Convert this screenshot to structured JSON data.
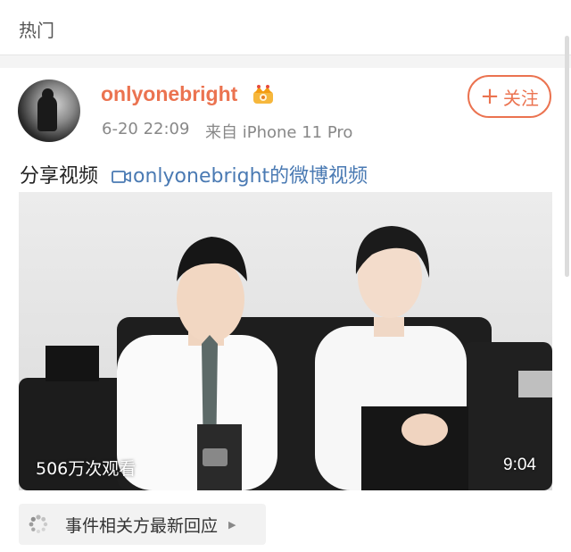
{
  "header": {
    "title": "热门"
  },
  "post": {
    "username": "onlyonebright",
    "timestamp": "6-20 22:09",
    "source": "来自 iPhone 11 Pro",
    "follow_label": "关注",
    "follow_plus": "+",
    "text_prefix": "分享视频",
    "link_text": "onlyonebright的微博视频",
    "video": {
      "views": "506万次观看",
      "duration": "9:04"
    },
    "event_chip_label": "事件相关方最新回应"
  },
  "colors": {
    "accent": "#eb7350",
    "link": "#4a7ab3",
    "chip_bg": "#f2f2f2"
  },
  "icons": [
    "vip-crown-icon",
    "video-link-icon",
    "loading-spinner-icon",
    "chevron-right-icon",
    "plus-icon"
  ]
}
